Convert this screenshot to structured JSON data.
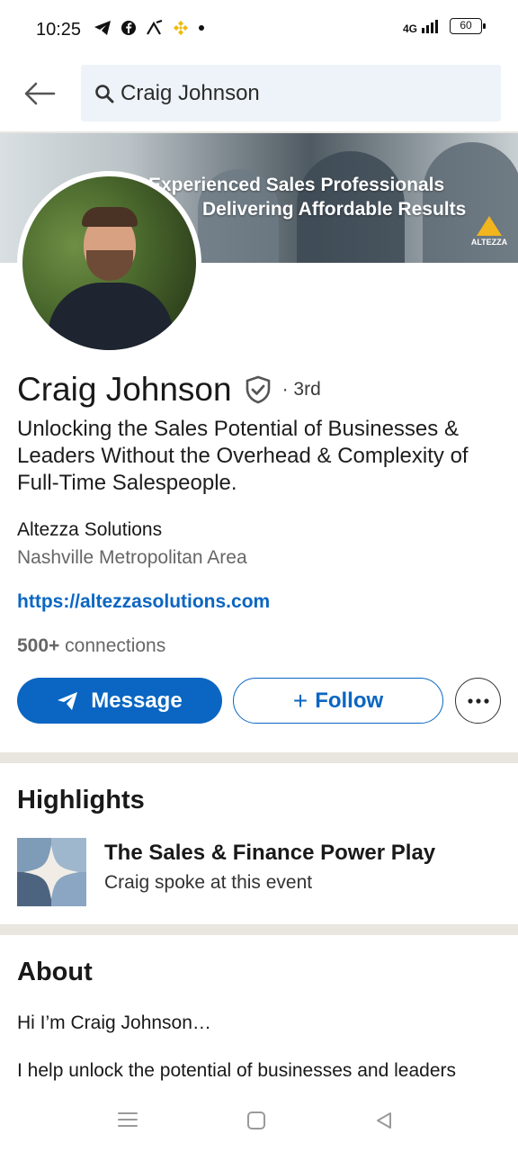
{
  "status_bar": {
    "time": "10:25",
    "network": "4G",
    "battery": "60",
    "notification_icons": [
      "telegram-icon",
      "facebook-icon",
      "antenna-icon",
      "binance-icon",
      "dot-icon"
    ]
  },
  "search": {
    "query": "Craig Johnson"
  },
  "banner": {
    "line1": "Experienced Sales Professionals",
    "line2": "Delivering Affordable Results",
    "logo_text": "ALTEZZA"
  },
  "profile": {
    "name": "Craig Johnson",
    "degree": "· 3rd",
    "headline": "Unlocking the Sales Potential of Businesses & Leaders Without the Overhead & Complexity of Full-Time Salespeople.",
    "company": "Altezza Solutions",
    "location": "Nashville Metropolitan Area",
    "website": "https://altezzasolutions.com",
    "connections_count": "500+",
    "connections_label": "connections"
  },
  "actions": {
    "message_label": "Message",
    "follow_label": "Follow"
  },
  "highlights": {
    "title": "Highlights",
    "item_title": "The Sales & Finance Power Play",
    "item_subtitle": "Craig spoke at this event"
  },
  "about": {
    "title": "About",
    "line1": "Hi I’m Craig Johnson…",
    "line2": "I help unlock the potential of businesses and leaders"
  },
  "colors": {
    "primary": "#0a66c2",
    "search_bg": "#edf3f8",
    "section_gap": "#e9e5df",
    "banner_logo": "#f2b51d"
  }
}
